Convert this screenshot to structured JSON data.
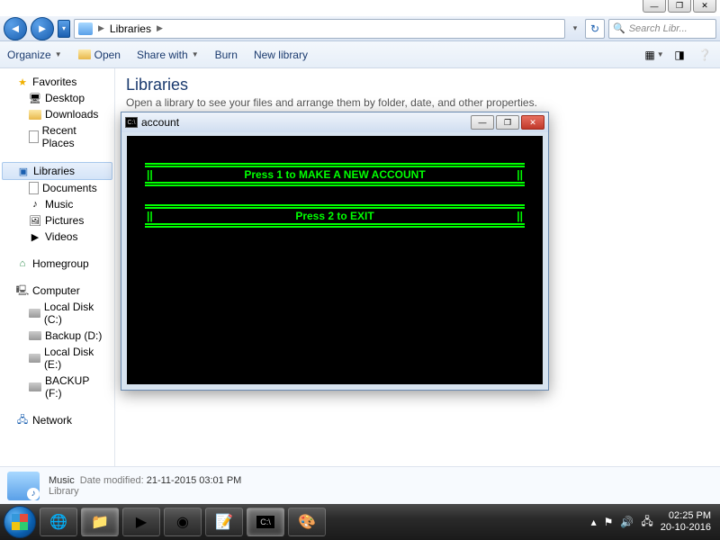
{
  "window_controls": {
    "min": "—",
    "max": "❐",
    "close": "✕"
  },
  "navbar": {
    "breadcrumb_root": "Libraries",
    "search_placeholder": "Search Libr..."
  },
  "toolbar": {
    "organize": "Organize",
    "open": "Open",
    "share": "Share with",
    "burn": "Burn",
    "newlib": "New library"
  },
  "sidebar": {
    "favorites": {
      "label": "Favorites",
      "items": [
        "Desktop",
        "Downloads",
        "Recent Places"
      ]
    },
    "libraries": {
      "label": "Libraries",
      "items": [
        "Documents",
        "Music",
        "Pictures",
        "Videos"
      ]
    },
    "homegroup": {
      "label": "Homegroup"
    },
    "computer": {
      "label": "Computer",
      "items": [
        "Local Disk (C:)",
        "Backup (D:)",
        "Local Disk  (E:)",
        "BACKUP (F:)"
      ]
    },
    "network": {
      "label": "Network"
    }
  },
  "content": {
    "title": "Libraries",
    "subtitle": "Open a library to see your files and arrange them by folder, date, and other properties."
  },
  "console": {
    "title": "account",
    "line1": "Press 1 to MAKE A NEW ACCOUNT",
    "line2": "Press 2 to EXIT"
  },
  "details": {
    "name": "Music",
    "mod_label": "Date modified:",
    "mod_value": "21-11-2015  03:01 PM",
    "type": "Library"
  },
  "tray": {
    "time": "02:25 PM",
    "date": "20-10-2016"
  }
}
